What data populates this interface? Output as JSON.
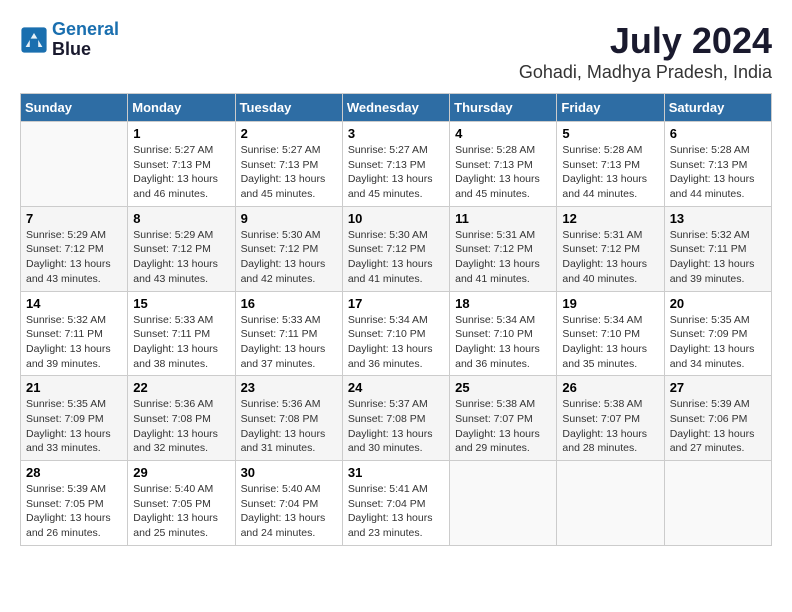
{
  "header": {
    "logo_line1": "General",
    "logo_line2": "Blue",
    "month_year": "July 2024",
    "location": "Gohadi, Madhya Pradesh, India"
  },
  "days_of_week": [
    "Sunday",
    "Monday",
    "Tuesday",
    "Wednesday",
    "Thursday",
    "Friday",
    "Saturday"
  ],
  "weeks": [
    [
      {
        "day": "",
        "info": ""
      },
      {
        "day": "1",
        "info": "Sunrise: 5:27 AM\nSunset: 7:13 PM\nDaylight: 13 hours\nand 46 minutes."
      },
      {
        "day": "2",
        "info": "Sunrise: 5:27 AM\nSunset: 7:13 PM\nDaylight: 13 hours\nand 45 minutes."
      },
      {
        "day": "3",
        "info": "Sunrise: 5:27 AM\nSunset: 7:13 PM\nDaylight: 13 hours\nand 45 minutes."
      },
      {
        "day": "4",
        "info": "Sunrise: 5:28 AM\nSunset: 7:13 PM\nDaylight: 13 hours\nand 45 minutes."
      },
      {
        "day": "5",
        "info": "Sunrise: 5:28 AM\nSunset: 7:13 PM\nDaylight: 13 hours\nand 44 minutes."
      },
      {
        "day": "6",
        "info": "Sunrise: 5:28 AM\nSunset: 7:13 PM\nDaylight: 13 hours\nand 44 minutes."
      }
    ],
    [
      {
        "day": "7",
        "info": "Sunrise: 5:29 AM\nSunset: 7:12 PM\nDaylight: 13 hours\nand 43 minutes."
      },
      {
        "day": "8",
        "info": "Sunrise: 5:29 AM\nSunset: 7:12 PM\nDaylight: 13 hours\nand 43 minutes."
      },
      {
        "day": "9",
        "info": "Sunrise: 5:30 AM\nSunset: 7:12 PM\nDaylight: 13 hours\nand 42 minutes."
      },
      {
        "day": "10",
        "info": "Sunrise: 5:30 AM\nSunset: 7:12 PM\nDaylight: 13 hours\nand 41 minutes."
      },
      {
        "day": "11",
        "info": "Sunrise: 5:31 AM\nSunset: 7:12 PM\nDaylight: 13 hours\nand 41 minutes."
      },
      {
        "day": "12",
        "info": "Sunrise: 5:31 AM\nSunset: 7:12 PM\nDaylight: 13 hours\nand 40 minutes."
      },
      {
        "day": "13",
        "info": "Sunrise: 5:32 AM\nSunset: 7:11 PM\nDaylight: 13 hours\nand 39 minutes."
      }
    ],
    [
      {
        "day": "14",
        "info": "Sunrise: 5:32 AM\nSunset: 7:11 PM\nDaylight: 13 hours\nand 39 minutes."
      },
      {
        "day": "15",
        "info": "Sunrise: 5:33 AM\nSunset: 7:11 PM\nDaylight: 13 hours\nand 38 minutes."
      },
      {
        "day": "16",
        "info": "Sunrise: 5:33 AM\nSunset: 7:11 PM\nDaylight: 13 hours\nand 37 minutes."
      },
      {
        "day": "17",
        "info": "Sunrise: 5:34 AM\nSunset: 7:10 PM\nDaylight: 13 hours\nand 36 minutes."
      },
      {
        "day": "18",
        "info": "Sunrise: 5:34 AM\nSunset: 7:10 PM\nDaylight: 13 hours\nand 36 minutes."
      },
      {
        "day": "19",
        "info": "Sunrise: 5:34 AM\nSunset: 7:10 PM\nDaylight: 13 hours\nand 35 minutes."
      },
      {
        "day": "20",
        "info": "Sunrise: 5:35 AM\nSunset: 7:09 PM\nDaylight: 13 hours\nand 34 minutes."
      }
    ],
    [
      {
        "day": "21",
        "info": "Sunrise: 5:35 AM\nSunset: 7:09 PM\nDaylight: 13 hours\nand 33 minutes."
      },
      {
        "day": "22",
        "info": "Sunrise: 5:36 AM\nSunset: 7:08 PM\nDaylight: 13 hours\nand 32 minutes."
      },
      {
        "day": "23",
        "info": "Sunrise: 5:36 AM\nSunset: 7:08 PM\nDaylight: 13 hours\nand 31 minutes."
      },
      {
        "day": "24",
        "info": "Sunrise: 5:37 AM\nSunset: 7:08 PM\nDaylight: 13 hours\nand 30 minutes."
      },
      {
        "day": "25",
        "info": "Sunrise: 5:38 AM\nSunset: 7:07 PM\nDaylight: 13 hours\nand 29 minutes."
      },
      {
        "day": "26",
        "info": "Sunrise: 5:38 AM\nSunset: 7:07 PM\nDaylight: 13 hours\nand 28 minutes."
      },
      {
        "day": "27",
        "info": "Sunrise: 5:39 AM\nSunset: 7:06 PM\nDaylight: 13 hours\nand 27 minutes."
      }
    ],
    [
      {
        "day": "28",
        "info": "Sunrise: 5:39 AM\nSunset: 7:05 PM\nDaylight: 13 hours\nand 26 minutes."
      },
      {
        "day": "29",
        "info": "Sunrise: 5:40 AM\nSunset: 7:05 PM\nDaylight: 13 hours\nand 25 minutes."
      },
      {
        "day": "30",
        "info": "Sunrise: 5:40 AM\nSunset: 7:04 PM\nDaylight: 13 hours\nand 24 minutes."
      },
      {
        "day": "31",
        "info": "Sunrise: 5:41 AM\nSunset: 7:04 PM\nDaylight: 13 hours\nand 23 minutes."
      },
      {
        "day": "",
        "info": ""
      },
      {
        "day": "",
        "info": ""
      },
      {
        "day": "",
        "info": ""
      }
    ]
  ]
}
